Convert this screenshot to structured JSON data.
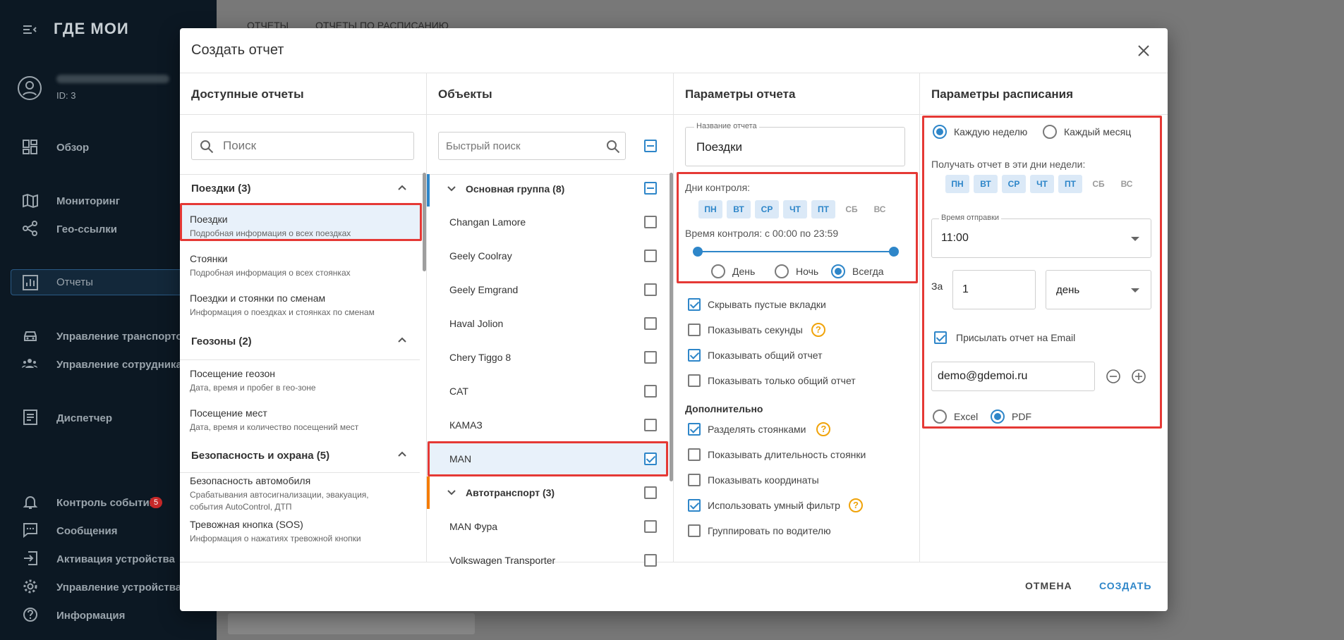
{
  "app": {
    "logo": "ГДЕ МОИ"
  },
  "sidebar": {
    "user_id": "ID: 3",
    "items": [
      {
        "label": "Обзор",
        "icon": "dashboard-icon"
      },
      {
        "label": "Мониторинг",
        "icon": "map-icon"
      },
      {
        "label": "Гео-ссылки",
        "icon": "share-icon"
      },
      {
        "label": "Отчеты",
        "icon": "reports-icon"
      },
      {
        "label": "Управление транспортом",
        "icon": "car-icon"
      },
      {
        "label": "Управление сотрудниками",
        "icon": "people-icon"
      },
      {
        "label": "Диспетчер",
        "icon": "dispatcher-icon"
      },
      {
        "label": "Контроль событий",
        "icon": "bell-icon",
        "badge": "5"
      },
      {
        "label": "Сообщения",
        "icon": "chat-icon"
      },
      {
        "label": "Активация устройства",
        "icon": "login-icon"
      },
      {
        "label": "Управление устройствами",
        "icon": "gear-icon"
      },
      {
        "label": "Информация",
        "icon": "help-icon"
      }
    ]
  },
  "background": {
    "tabs": [
      "ОТЧЕТЫ",
      "ОТЧЕТЫ ПО РАСПИСАНИЮ"
    ]
  },
  "modal": {
    "title": "Создать отчет",
    "columns": {
      "reports": "Доступные отчеты",
      "objects": "Объекты",
      "params": "Параметры отчета",
      "schedule": "Параметры расписания"
    },
    "reports_search_placeholder": "Поиск",
    "report_groups": [
      {
        "title": "Поездки (3)",
        "items": [
          {
            "title": "Поездки",
            "subtitle": "Подробная информация о всех поездках"
          },
          {
            "title": "Стоянки",
            "subtitle": "Подробная информация о всех стоянках"
          },
          {
            "title": "Поездки и стоянки по сменам",
            "subtitle": "Информация о поездках и стоянках по сменам"
          }
        ]
      },
      {
        "title": "Геозоны (2)",
        "items": [
          {
            "title": "Посещение геозон",
            "subtitle": "Дата, время и пробег в гео-зоне"
          },
          {
            "title": "Посещение мест",
            "subtitle": "Дата, время и количество посещений мест"
          }
        ]
      },
      {
        "title": "Безопасность и охрана (5)",
        "items": [
          {
            "title": "Безопасность автомобиля",
            "subtitle": "Срабатывания автосигнализации, эвакуация,",
            "subtitle2": "события AutoControl, ДТП"
          },
          {
            "title": "Тревожная кнопка (SOS)",
            "subtitle": "Информация о нажатиях тревожной кнопки"
          }
        ]
      }
    ],
    "objects_search_placeholder": "Быстрый поиск",
    "object_groups": [
      {
        "title": "Основная группа (8)"
      },
      {
        "title": "Автотранспорт (3)"
      }
    ],
    "objects": [
      "Changan Lamore",
      "Geely Coolray",
      "Geely Emgrand",
      "Haval Jolion",
      "Chery Tiggo 8",
      "CAT",
      "КАМАЗ",
      "MAN",
      "MAN Фура",
      "Volkswagen Transporter"
    ],
    "params": {
      "name_label": "Название отчета",
      "name_value": "Поездки",
      "days_label": "Дни контроля:",
      "days": [
        "ПН",
        "ВТ",
        "СР",
        "ЧТ",
        "ПТ",
        "СБ",
        "ВС"
      ],
      "days_selected": [
        true,
        true,
        true,
        true,
        true,
        false,
        false
      ],
      "time_label": "Время контроля: с 00:00 по 23:59",
      "period_options": [
        "День",
        "Ночь",
        "Всегда"
      ],
      "period_selected": "Всегда",
      "checks": [
        {
          "label": "Скрывать пустые вкладки",
          "checked": true
        },
        {
          "label": "Показывать секунды",
          "checked": false,
          "help": "?"
        },
        {
          "label": "Показывать общий отчет",
          "checked": true
        },
        {
          "label": "Показывать только общий отчет",
          "checked": false
        }
      ],
      "extra_title": "Дополнительно",
      "extra_checks": [
        {
          "label": "Разделять стоянками",
          "checked": true,
          "help": "?"
        },
        {
          "label": "Показывать длительность стоянки",
          "checked": false
        },
        {
          "label": "Показывать координаты",
          "checked": false
        },
        {
          "label": "Использовать умный фильтр",
          "checked": true,
          "help": "?"
        },
        {
          "label": "Группировать по водителю",
          "checked": false
        }
      ]
    },
    "schedule": {
      "frequency_options": [
        "Каждую неделю",
        "Каждый месяц"
      ],
      "frequency_selected": "Каждую неделю",
      "days_label": "Получать отчет в эти дни недели:",
      "days": [
        "ПН",
        "ВТ",
        "СР",
        "ЧТ",
        "ПТ",
        "СБ",
        "ВС"
      ],
      "send_time_label": "Время отправки",
      "send_time_value": "11:00",
      "period_prefix": "За",
      "period_count": "1",
      "period_unit": "день",
      "email_check_label": "Присылать отчет на Email",
      "email_value": "demo@gdemoi.ru",
      "format_options": [
        "Excel",
        "PDF"
      ],
      "format_selected": "PDF"
    },
    "buttons": {
      "cancel": "ОТМЕНА",
      "create": "СОЗДАТЬ"
    }
  },
  "colors": {
    "accent": "#2e86c9",
    "highlight": "#e53935",
    "sidebar": "#0c1823",
    "badge": "#c62828"
  }
}
